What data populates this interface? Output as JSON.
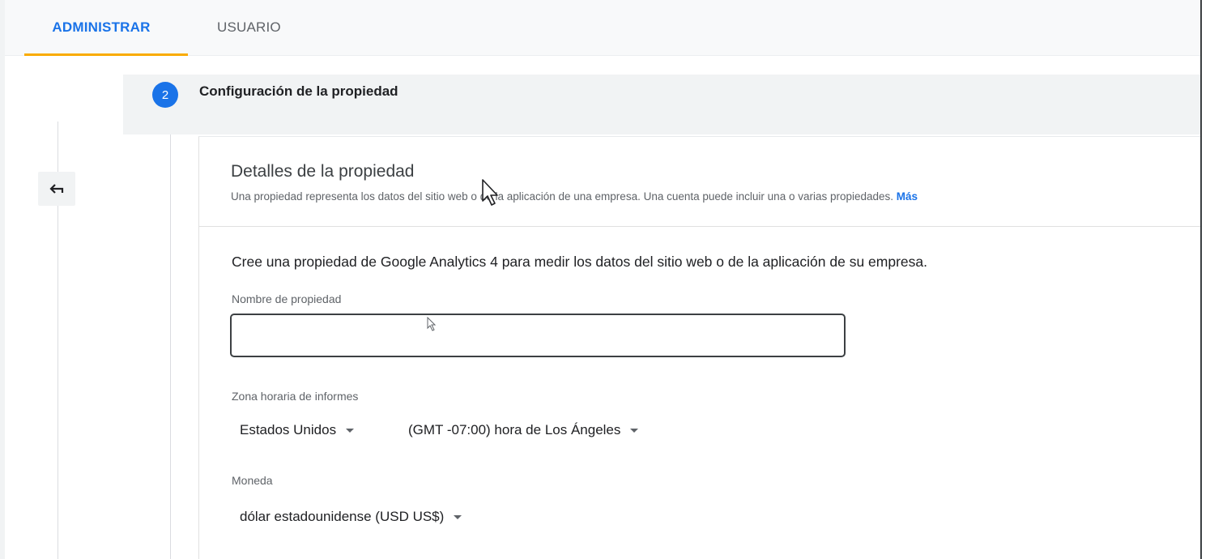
{
  "tabs": [
    {
      "label": "ADMINISTRAR",
      "active": true
    },
    {
      "label": "USUARIO",
      "active": false
    }
  ],
  "step": {
    "number": "2",
    "title": "Configuración de la propiedad"
  },
  "card": {
    "title": "Detalles de la propiedad",
    "subtitle": "Una propiedad representa los datos del sitio web o de la aplicación de una empresa. Una cuenta puede incluir una o varias propiedades.",
    "more_link": "Más"
  },
  "form": {
    "intro": "Cree una propiedad de Google Analytics 4 para medir los datos del sitio web o de la aplicación de su empresa.",
    "property_name_label": "Nombre de propiedad",
    "property_name_value": "",
    "timezone_label": "Zona horaria de informes",
    "country_value": "Estados Unidos",
    "timezone_value": "(GMT -07:00) hora de Los Ángeles",
    "currency_label": "Moneda",
    "currency_value": "dólar estadounidense (USD US$)"
  },
  "icons": {
    "back": "back-arrow-icon",
    "dropdown": "caret-down-icon",
    "pointer": "mouse-pointer-icon"
  },
  "colors": {
    "accent": "#1a73e8",
    "tab_underline": "#f9ab00"
  }
}
